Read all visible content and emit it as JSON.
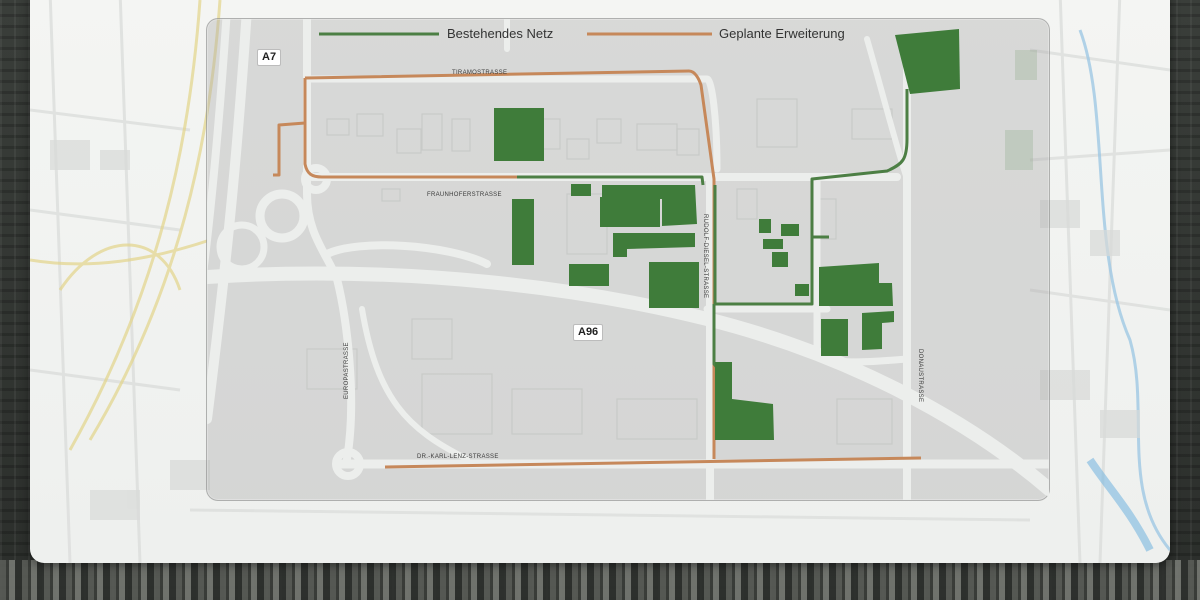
{
  "legend": {
    "existing_label": "Bestehendes Netz",
    "planned_label": "Geplante Erweiterung"
  },
  "highways": {
    "a7": "A7",
    "a96": "A96"
  },
  "streets": {
    "tiramo": "TIRAMOSTRASSE",
    "fraunhofer": "FRAUNHOFERSTRASSE",
    "rudolf_diesel": "RUDOLF-DIESEL-STRASSE",
    "donau": "DONAUSTRASSE",
    "europa": "EUROPASTRASSE",
    "karl_lenz": "DR.-KARL-LENZ-STRASSE"
  },
  "colors": {
    "existing_network": "#4c7f44",
    "planned_expansion": "#c6885a",
    "buildings": "#3f7c3a",
    "roads": "#e9ebe9"
  }
}
